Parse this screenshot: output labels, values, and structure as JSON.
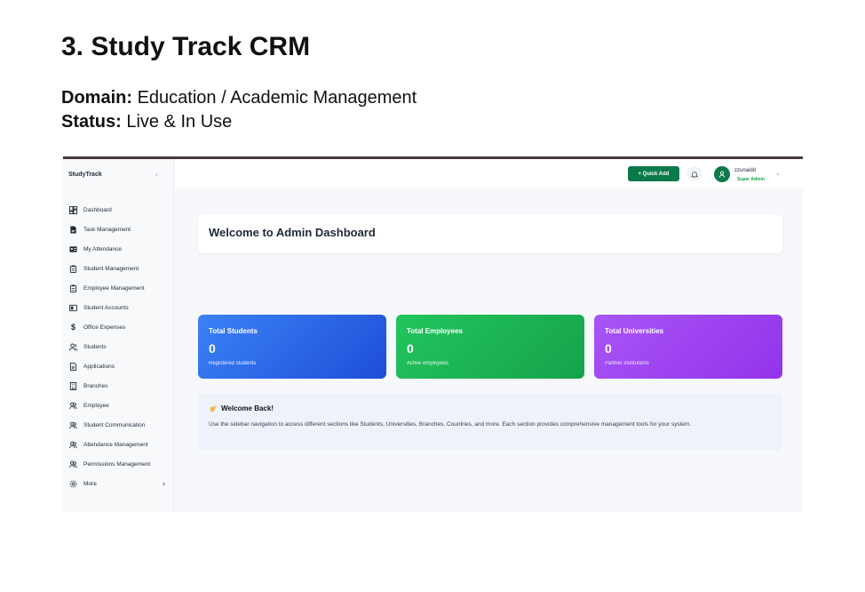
{
  "doc": {
    "title": "3. Study Track CRM",
    "domain_label": "Domain:",
    "domain_value": "Education / Academic Management",
    "status_label": "Status:",
    "status_value": "Live & In Use"
  },
  "app": {
    "brand": "StudyTrack",
    "collapse_icon": "chevron-left-icon",
    "accent_color": "#0b7a4b",
    "sidebar": {
      "items": [
        {
          "label": "Dashboard",
          "icon": "dashboard-icon"
        },
        {
          "label": "Task Management",
          "icon": "file-icon"
        },
        {
          "label": "My Attendance",
          "icon": "id-card-icon"
        },
        {
          "label": "Student Management",
          "icon": "clipboard-icon"
        },
        {
          "label": "Employee Management",
          "icon": "clipboard-icon"
        },
        {
          "label": "Student Accounts",
          "icon": "account-icon"
        },
        {
          "label": "Office Expenses",
          "icon": "dollar-icon"
        },
        {
          "label": "Students",
          "icon": "users-icon"
        },
        {
          "label": "Applications",
          "icon": "document-icon"
        },
        {
          "label": "Branches",
          "icon": "building-icon"
        },
        {
          "label": "Employee",
          "icon": "people-icon"
        },
        {
          "label": "Student Communication",
          "icon": "people-icon"
        },
        {
          "label": "Attendance Management",
          "icon": "people-icon"
        },
        {
          "label": "Permissions Management",
          "icon": "people-icon"
        },
        {
          "label": "More",
          "icon": "gear-icon"
        }
      ]
    },
    "topbar": {
      "quick_add": "+ Quick Add",
      "user_name": "zzunaidd",
      "user_role": "Super Admin"
    },
    "welcome_title": "Welcome to Admin Dashboard",
    "stats": [
      {
        "title": "Total Students",
        "value": "0",
        "subtitle": "Registered students",
        "color": "#2563eb"
      },
      {
        "title": "Total Employees",
        "value": "0",
        "subtitle": "Active employees",
        "color": "#16a34a"
      },
      {
        "title": "Total Universities",
        "value": "0",
        "subtitle": "Partner institutions",
        "color": "#9333ea"
      }
    ],
    "info": {
      "heading": "Welcome Back!",
      "body": "Use the sidebar navigation to access different sections like Students, Universities, Branches, Countries, and more. Each section provides comprehensive management tools for your system."
    }
  }
}
